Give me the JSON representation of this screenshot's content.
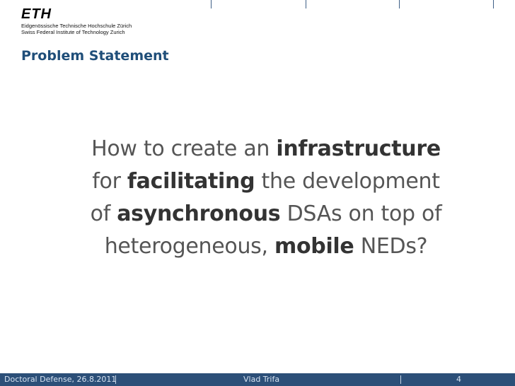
{
  "logo": {
    "mark": "ETH",
    "line1": "Eidgenössische Technische Hochschule Zürich",
    "line2": "Swiss Federal Institute of Technology Zurich"
  },
  "slide": {
    "title": "Problem Statement",
    "question": {
      "w01": "How to create an",
      "w02": "infrastructure",
      "w03": "for",
      "w04": "facilitating",
      "w05": "the development",
      "w06": "of",
      "w07": "asynchronous",
      "w08": "DSAs on top of",
      "w09": "heterogeneous,",
      "w10": "mobile",
      "w11": "NEDs?"
    }
  },
  "footer": {
    "left": "Doctoral Defense, 26.8.2011",
    "center": "Vlad Trifa",
    "page": "4"
  },
  "colors": {
    "title": "#1f4e79",
    "footer_bg": "#2c4f78",
    "body_text": "#555555"
  }
}
